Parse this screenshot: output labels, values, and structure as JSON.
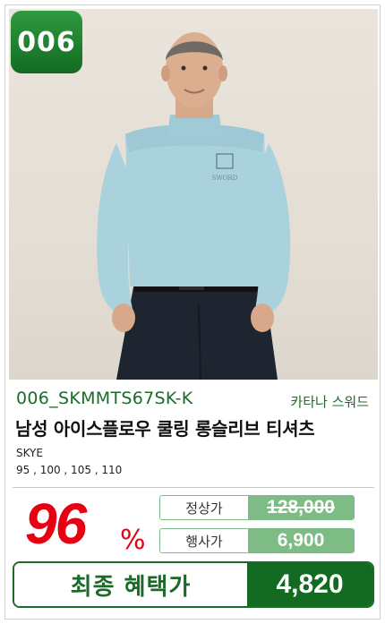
{
  "badge": "006",
  "product": {
    "code": "006_SKMMTS67SK-K",
    "brand": "카타나 스워드",
    "title": "남성 아이스플로우 쿨링 롱슬리브 티셔츠",
    "color": "SKYE",
    "sizes": "95 , 100 , 105 , 110"
  },
  "pricing": {
    "discount_value": "96",
    "discount_sign": "%",
    "regular_label": "정상가",
    "regular_price": "128,000",
    "event_label": "행사가",
    "event_price": "6,900",
    "final_label": "최종 혜택가",
    "final_price": "4,820"
  },
  "image": {
    "logo_text": "SWORD",
    "shirt_color": "#a9d2dc"
  }
}
